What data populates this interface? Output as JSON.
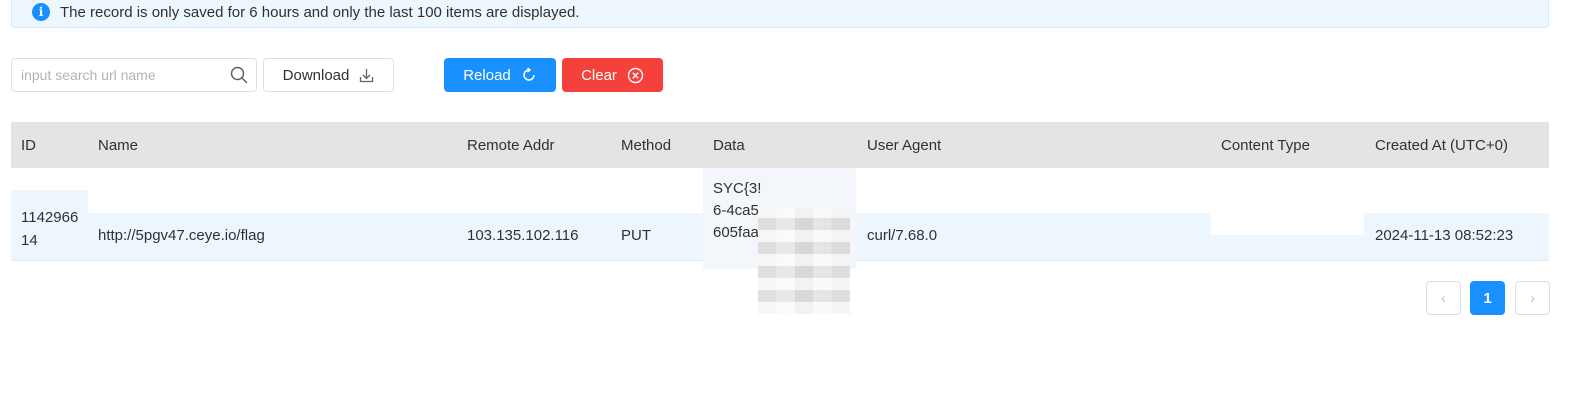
{
  "alert": {
    "text": "The record is only saved for 6 hours and only the last 100 items are displayed.",
    "icon": "info-icon",
    "color": "#1890ff"
  },
  "toolbar": {
    "search_placeholder": "input search url name",
    "search_value": "",
    "download_label": "Download",
    "reload_label": "Reload",
    "clear_label": "Clear",
    "reload_color": "#1890ff",
    "clear_color": "#f5413b"
  },
  "table": {
    "columns": [
      "ID",
      "Name",
      "Remote Addr",
      "Method",
      "Data",
      "User Agent",
      "Content Type",
      "Created At (UTC+0)"
    ],
    "rows": [
      {
        "id_line1": "1142966",
        "id_line2": "14",
        "name": "http://5pgv47.ceye.io/flag",
        "remote_addr": "103.135.102.116",
        "method": "PUT",
        "data_line1": "SYC{3!",
        "data_line2": "6-4ca5",
        "data_line3": "605faa",
        "user_agent": "curl/7.68.0",
        "content_type": "",
        "created_at": "2024-11-13 08:52:23"
      }
    ]
  },
  "pagination": {
    "prev": "‹",
    "current": "1",
    "next": "›"
  }
}
